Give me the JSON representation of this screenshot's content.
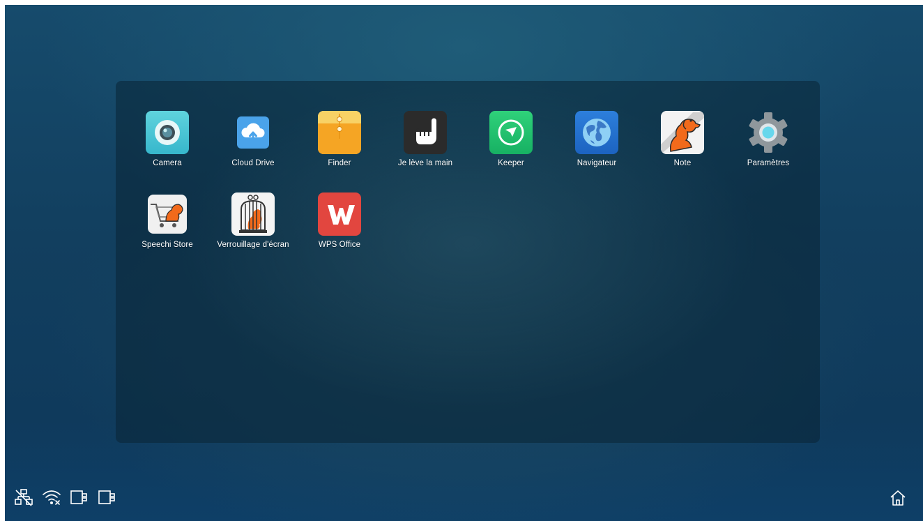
{
  "apps": [
    {
      "label": "Camera",
      "icon": "camera-icon"
    },
    {
      "label": "Cloud Drive",
      "icon": "cloud-upload-icon"
    },
    {
      "label": "Finder",
      "icon": "folder-envelope-icon"
    },
    {
      "label": "Je lève la main",
      "icon": "raised-hand-icon"
    },
    {
      "label": "Keeper",
      "icon": "broom-check-icon"
    },
    {
      "label": "Navigateur",
      "icon": "globe-icon"
    },
    {
      "label": "Note",
      "icon": "dog-note-icon"
    },
    {
      "label": "Paramètres",
      "icon": "gear-icon"
    },
    {
      "label": "Speechi Store",
      "icon": "dog-cart-icon"
    },
    {
      "label": "Verrouillage d'écran",
      "icon": "dog-cage-lock-icon"
    },
    {
      "label": "WPS Office",
      "icon": "wps-logo-icon"
    }
  ],
  "status_icons": [
    "ethernet-disconnected-icon",
    "wifi-off-icon",
    "usb-device-icon",
    "usb-device-icon"
  ],
  "nav": {
    "home_icon": "home-icon"
  },
  "colors": {
    "background": "#123f5f",
    "drawer": "#0a2434",
    "label_text": "#ffffff"
  }
}
